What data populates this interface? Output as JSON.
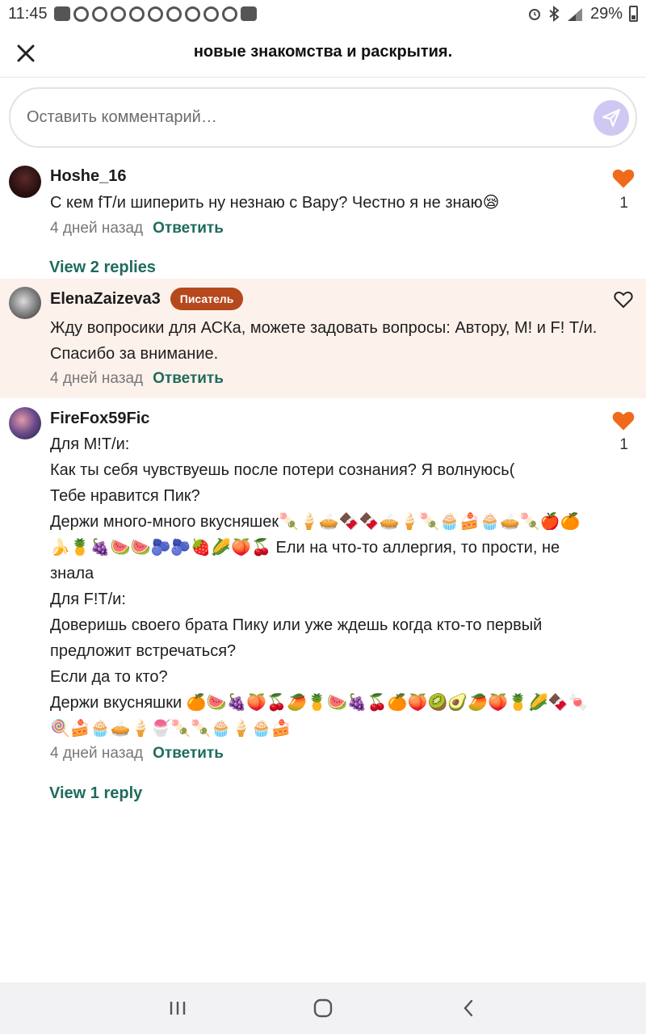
{
  "status_bar": {
    "time": "11:45",
    "battery": "29%",
    "icons": [
      "message-icon",
      "telegram-icon",
      "recycle-icon",
      "pinterest-icon",
      "gallery-icon"
    ]
  },
  "header": {
    "title": "новые знакомства и раскрытия.",
    "close_icon": "close-icon"
  },
  "comment_input": {
    "placeholder": "Оставить комментарий…",
    "send_icon": "send-icon",
    "send_color": "#cfc8f3"
  },
  "comments": [
    {
      "username": "Hoshe_16",
      "lines": [
        "С кем fТ/и шиперить ну незнаю с Вару?  Честно я не знаю😪"
      ],
      "time": "4 дней назад",
      "reply_label": "Ответить",
      "liked": true,
      "likes": "1",
      "view_replies": "View 2 replies"
    },
    {
      "username": "ElenaZaizeva3",
      "badge": "Писатель",
      "lines": [
        "Жду вопросики для АСКа, можете задовать вопросы: Автору, М! и F! Т/и.",
        "Спасибо за внимание."
      ],
      "time": "4 дней назад",
      "reply_label": "Ответить",
      "liked": false,
      "likes": ""
    },
    {
      "username": "FireFox59Fic",
      "lines": [
        "Для М!Т/и:",
        "Как ты себя чувствуешь после потери сознания? Я волнуюсь(",
        "Тебе нравится Пик?",
        "Держи много-много вкусняшек🍡🍦🥧🍫🍫🥧🍦🍡🧁🍰🧁🥧🍡🍎🍊",
        "🍌🍍🍇🍉🍉🫐🫐🍓🌽🍑🍒 Ели на что-то аллергия, то прости, не",
        "знала",
        "Для F!Т/и:",
        "Доверишь своего брата Пику или уже ждешь когда кто-то первый",
        "предложит встречаться?",
        "Если да то кто?",
        "Держи вкусняшки 🍊🍉🍇🍑🍒🥭🍍🍉🍇🍒🍊🍑🥝🥑🥭🍑🍍🌽🍫🍬",
        "🍭🍰🧁🥧🍦🍧🍡🍡🧁🍦🧁🍰"
      ],
      "time": "4 дней назад",
      "reply_label": "Ответить",
      "liked": true,
      "likes": "1",
      "view_replies": "View 1 reply"
    }
  ],
  "colors": {
    "accent": "#1f6b5e",
    "like": "#f06a1c",
    "badge": "#b5481c",
    "highlight_bg": "#fdf1ec"
  },
  "nav_bar": {
    "icons": [
      "recent-apps-icon",
      "home-icon",
      "back-icon"
    ]
  }
}
